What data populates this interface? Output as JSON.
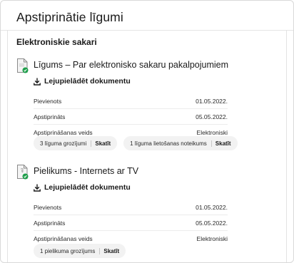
{
  "page": {
    "title": "Apstiprinātie līgumi"
  },
  "section": {
    "title": "Elektroniskie sakari"
  },
  "agreements": [
    {
      "title": "Līgums – Par elektronisko sakaru pakalpojumiem",
      "download_label": "Lejupielādēt dokumentu",
      "fields": [
        {
          "label": "Pievienots",
          "value": "01.05.2022."
        },
        {
          "label": "Apstiprināts",
          "value": "05.05.2022."
        },
        {
          "label": "Apstiprināšanas veids",
          "value": "Elektroniski"
        }
      ],
      "chips": [
        {
          "count": "3 līguma grozījumi",
          "view": "Skatīt"
        },
        {
          "count": "1 līguma lietošanas noteikums",
          "view": "Skatīt"
        }
      ]
    },
    {
      "title": "Pielikums - Internets ar TV",
      "download_label": "Lejupielādēt dokumentu",
      "fields": [
        {
          "label": "Pievienots",
          "value": "01.05.2022."
        },
        {
          "label": "Apstiprināts",
          "value": "05.05.2022."
        },
        {
          "label": "Apstiprināšanas veids",
          "value": "Elektroniski"
        }
      ],
      "chips": [
        {
          "count": "1 pielikuma grozījums",
          "view": "Skatīt"
        }
      ]
    }
  ],
  "icons": {
    "document": "document-approved-icon",
    "download": "download-icon"
  },
  "colors": {
    "approved_badge": "#1e9e4a"
  }
}
